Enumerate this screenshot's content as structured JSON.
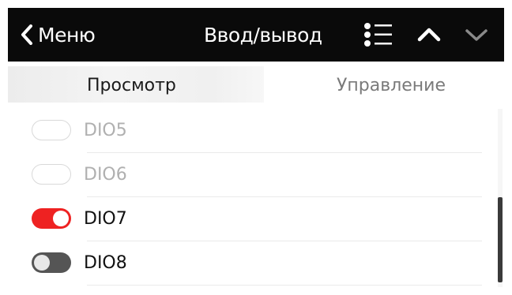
{
  "header": {
    "back_label": "Меню",
    "title": "Ввод/вывод",
    "icons": [
      "chevron-left-icon",
      "list-icon",
      "chevron-up-icon",
      "chevron-down-icon"
    ]
  },
  "tabs": [
    {
      "label": "Просмотр",
      "selected": true
    },
    {
      "label": "Управление",
      "selected": false
    }
  ],
  "items": [
    {
      "label": "DIO5",
      "state": "disabled"
    },
    {
      "label": "DIO6",
      "state": "disabled"
    },
    {
      "label": "DIO7",
      "state": "on"
    },
    {
      "label": "DIO8",
      "state": "off"
    }
  ],
  "colors": {
    "header_bg": "#0a0a0a",
    "toggle_on": "#ee2222",
    "toggle_off": "#555555",
    "text_dim": "#b0b0b0"
  }
}
